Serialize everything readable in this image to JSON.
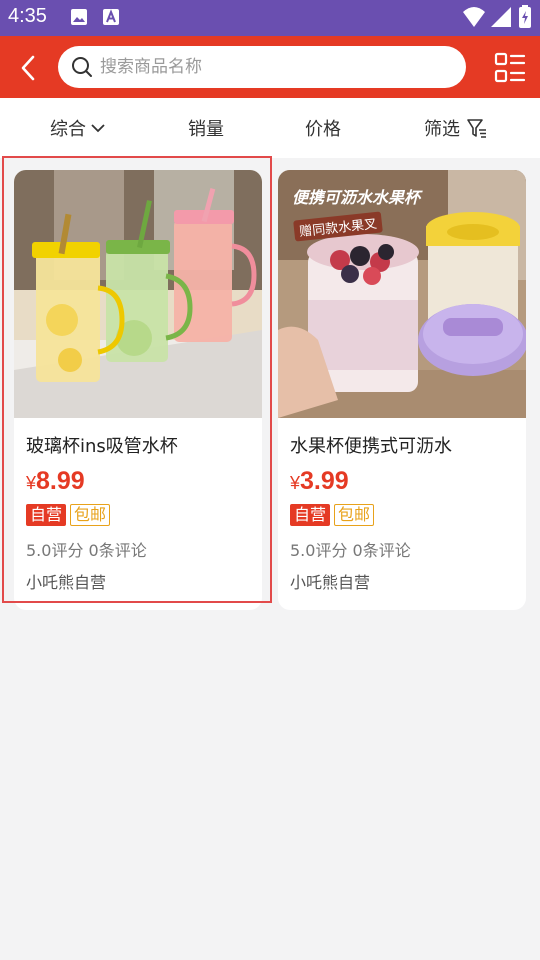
{
  "status_bar": {
    "time": "4:35"
  },
  "header": {
    "search_placeholder": "搜索商品名称"
  },
  "sort_bar": {
    "items": [
      {
        "label": "综合"
      },
      {
        "label": "销量"
      },
      {
        "label": "价格"
      },
      {
        "label": "筛选"
      }
    ]
  },
  "products": [
    {
      "title": "玻璃杯ins吸管水杯",
      "currency": "¥",
      "price": "8.99",
      "tags": [
        "自营",
        "包邮"
      ],
      "rating": "5.0评分 0条评论",
      "shop": "小吒熊自营"
    },
    {
      "title": "水果杯便携式可沥水",
      "currency": "¥",
      "price": "3.99",
      "tags": [
        "自营",
        "包邮"
      ],
      "rating": "5.0评分 0条评论",
      "shop": "小吒熊自营",
      "image_caption": "便携可沥水水果杯",
      "image_sticker": "赠同款水果叉"
    }
  ],
  "colors": {
    "accent": "#e53a24",
    "status_bar": "#6a4fb0",
    "tag_ship": "#e8a21b",
    "highlight": "#e24a4a"
  }
}
